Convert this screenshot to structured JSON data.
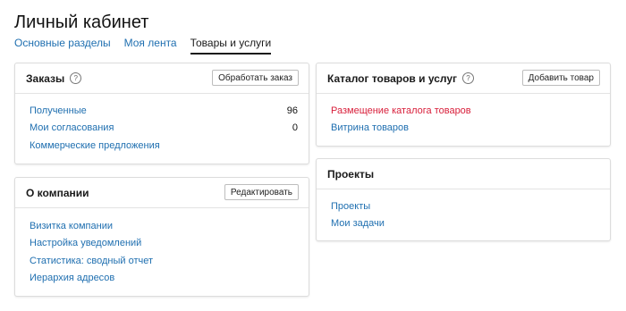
{
  "page": {
    "title": "Личный кабинет",
    "tabs": [
      {
        "label": "Основные разделы",
        "active": false
      },
      {
        "label": "Моя лента",
        "active": false
      },
      {
        "label": "Товары и услуги",
        "active": true
      }
    ]
  },
  "orders": {
    "title": "Заказы",
    "help_icon": "?",
    "button": "Обработать заказ",
    "items": [
      {
        "label": "Полученные",
        "count": "96"
      },
      {
        "label": "Мои согласования",
        "count": "0"
      },
      {
        "label": "Коммерческие предложения",
        "count": ""
      }
    ]
  },
  "company": {
    "title": "О компании",
    "button": "Редактировать",
    "items": [
      {
        "label": "Визитка компании"
      },
      {
        "label": "Настройка уведомлений"
      },
      {
        "label": "Статистика: сводный отчет"
      },
      {
        "label": "Иерархия адресов"
      }
    ]
  },
  "catalog": {
    "title": "Каталог товаров и услуг",
    "help_icon": "?",
    "button": "Добавить товар",
    "items": [
      {
        "label": "Размещение каталога товаров",
        "highlight": true
      },
      {
        "label": "Витрина товаров",
        "highlight": false
      }
    ]
  },
  "projects": {
    "title": "Проекты",
    "items": [
      {
        "label": "Проекты"
      },
      {
        "label": "Мои задачи"
      }
    ]
  },
  "colors": {
    "link": "#1f6fb0",
    "highlight_link": "#d81e3a",
    "border": "#dcdcdc"
  }
}
